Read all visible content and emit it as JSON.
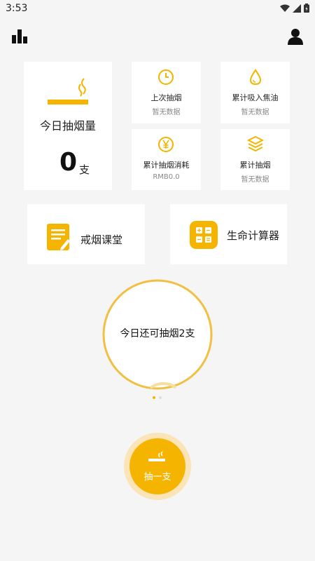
{
  "status_bar": {
    "time": "3:53"
  },
  "icons": {
    "stats": "bar-chart-icon",
    "profile": "user-icon",
    "cigarette": "cigarette-icon",
    "clock": "clock-icon",
    "drop": "drop-icon",
    "yen": "yen-icon",
    "layers": "layers-icon",
    "notebook": "notebook-icon",
    "calculator": "calculator-icon"
  },
  "today": {
    "label": "今日抽烟量",
    "count": "0",
    "unit": "支"
  },
  "stats": {
    "last_smoke": {
      "label": "上次抽烟",
      "value": "暂无数据"
    },
    "tar": {
      "label": "累计吸入焦油",
      "value": "暂无数据"
    },
    "spent": {
      "label": "累计抽烟消耗",
      "value": "RMB0.0"
    },
    "total": {
      "label": "累计抽烟",
      "value": "暂无数据"
    }
  },
  "features": {
    "classroom": "戒烟课堂",
    "life_calc": "生命计算器"
  },
  "ring": {
    "text": "今日还可抽烟2支"
  },
  "smoke_button": {
    "label": "抽一支"
  },
  "colors": {
    "accent": "#f5b400",
    "ring": "#f1c043",
    "bg": "#f5f5f5"
  }
}
